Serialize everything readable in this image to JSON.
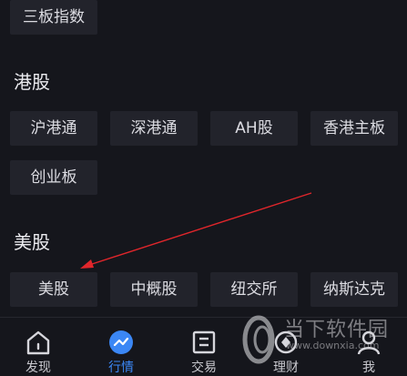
{
  "top": {
    "chip": "三板指数"
  },
  "hk": {
    "title": "港股",
    "chips": [
      "沪港通",
      "深港通",
      "AH股",
      "香港主板",
      "创业板"
    ]
  },
  "us": {
    "title": "美股",
    "chips": [
      "美股",
      "中概股",
      "纽交所",
      "纳斯达克"
    ]
  },
  "tabs": [
    {
      "label": "发现",
      "icon": "home-icon"
    },
    {
      "label": "行情",
      "icon": "trend-icon",
      "active": true
    },
    {
      "label": "交易",
      "icon": "trade-icon"
    },
    {
      "label": "理财",
      "icon": "finance-icon"
    },
    {
      "label": "我",
      "icon": "user-icon"
    }
  ],
  "watermark": {
    "title": "当下软件园",
    "url": "www.downxia.com"
  },
  "colors": {
    "background": "#15161c",
    "chip": "#22232b",
    "accent": "#3b87f5",
    "arrow": "#e0262b"
  }
}
